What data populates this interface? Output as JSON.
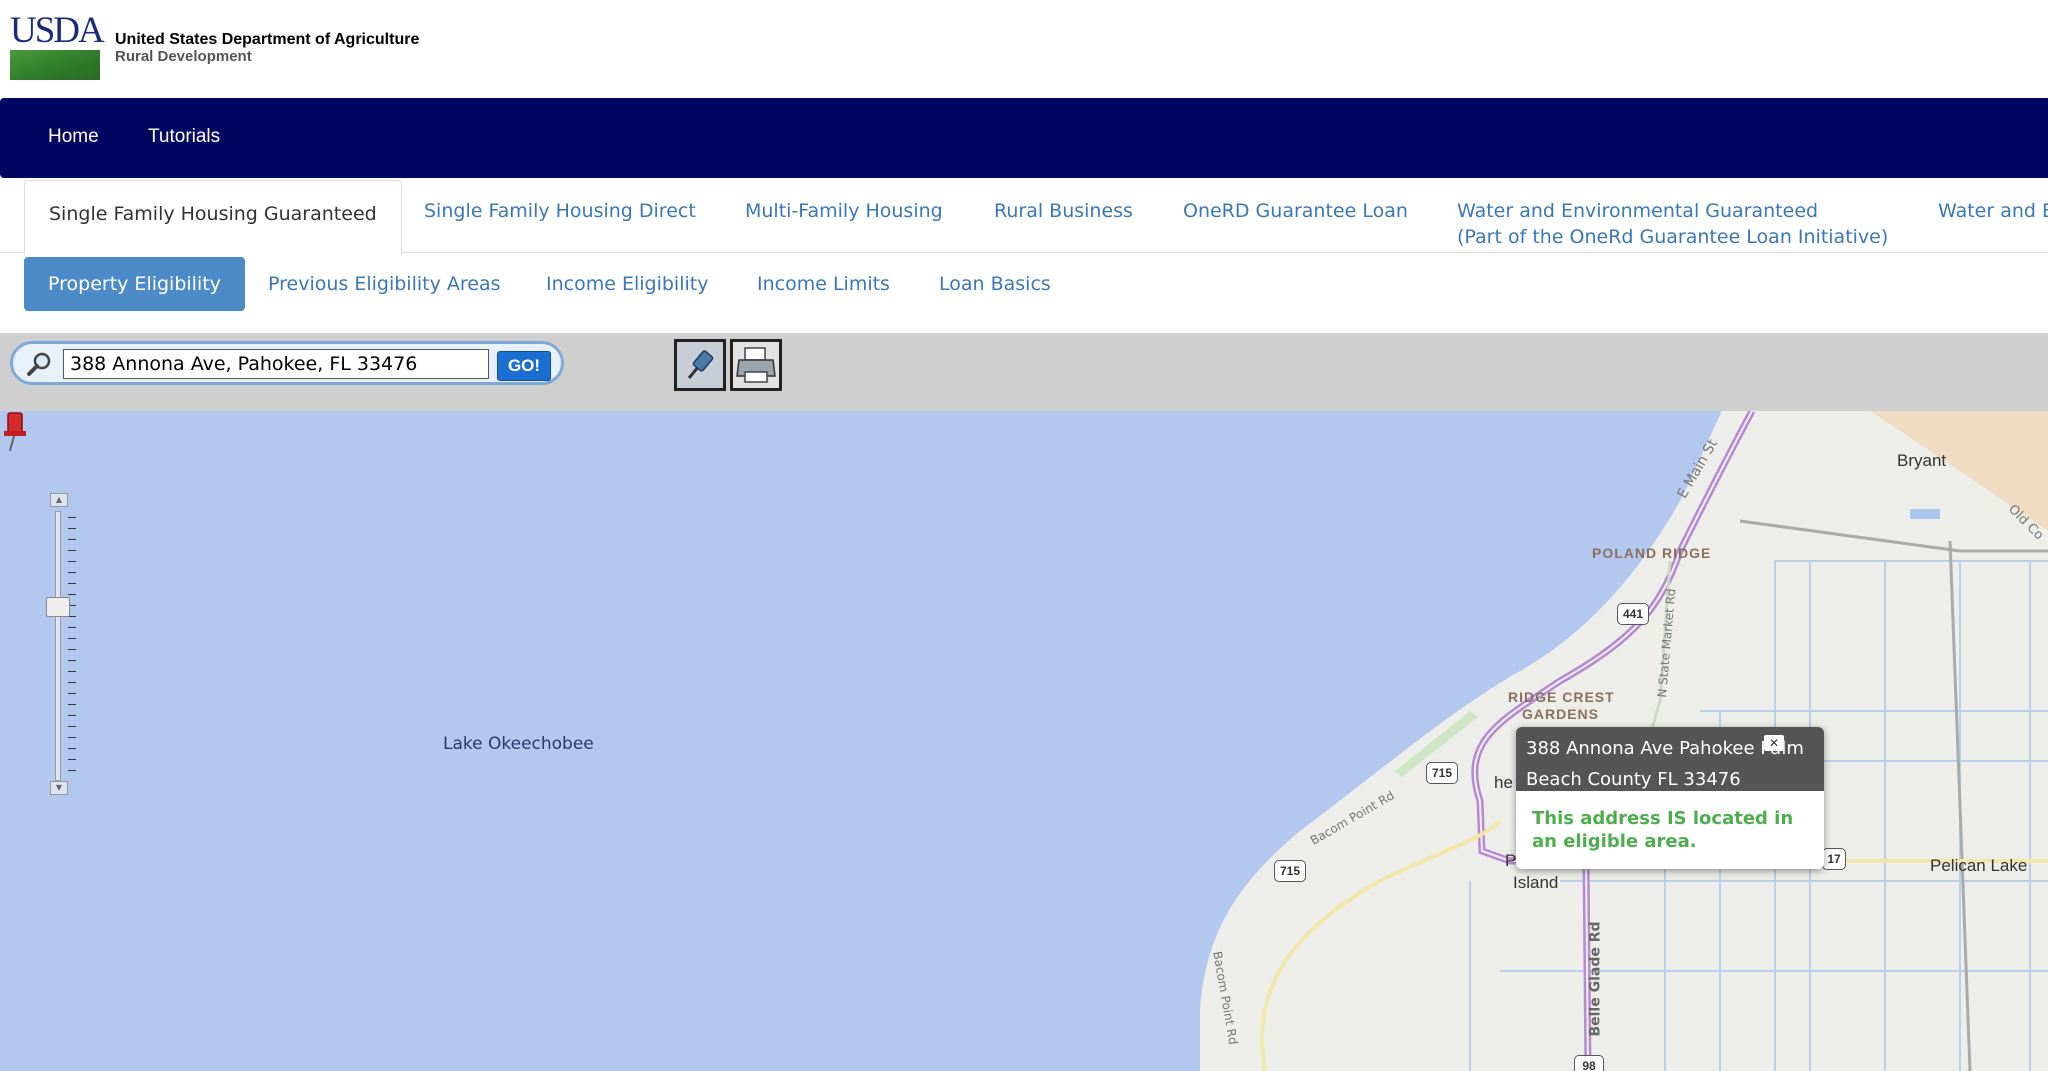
{
  "header": {
    "logo_text": "USDA",
    "agency_line1": "United States Department of Agriculture",
    "agency_line2": "Rural Development"
  },
  "topnav": {
    "home": "Home",
    "tutorials": "Tutorials"
  },
  "program_tabs": [
    {
      "label": "Single Family Housing Guaranteed",
      "active": true
    },
    {
      "label": "Single Family Housing Direct"
    },
    {
      "label": "Multi-Family Housing"
    },
    {
      "label": "Rural Business"
    },
    {
      "label": "OneRD Guarantee Loan"
    },
    {
      "label": "Water and Environmental Guaranteed",
      "label2": "(Part of the OneRd Guarantee Loan Initiative)"
    },
    {
      "label": "Water and E"
    }
  ],
  "sub_tabs": [
    {
      "label": "Property Eligibility",
      "active": true
    },
    {
      "label": "Previous Eligibility Areas"
    },
    {
      "label": "Income Eligibility"
    },
    {
      "label": "Income Limits"
    },
    {
      "label": "Loan Basics"
    }
  ],
  "search": {
    "value": "388 Annona Ave, Pahokee, FL 33476",
    "go_label": "GO!"
  },
  "map": {
    "lake_label": "Lake Okeechobee",
    "places": {
      "bryant": "Bryant",
      "poland_ridge": "POLAND RIDGE",
      "ridge_crest_1": "RIDGE CREST",
      "ridge_crest_2": "GARDENS",
      "pelican_lake": "Pelican Lake",
      "island_1": "P",
      "island_2": "Island",
      "pahokee_partial": "he"
    },
    "roads": {
      "e_main": "E Main St",
      "n_state_market": "N State Market Rd",
      "bacom_point_1": "Bacom Point Rd",
      "bacom_point_2": "Bacom Point Rd",
      "belle_glade": "Belle Glade Rd",
      "old_co": "Old Co"
    },
    "shields": {
      "s441": "441",
      "s715a": "715",
      "s715b": "715",
      "s17": "17",
      "s98": "98"
    }
  },
  "popup": {
    "address_line1": "388 Annona Ave Pahokee Palm",
    "address_line2": "Beach County FL 33476",
    "message": "This address IS located in an eligible area."
  }
}
